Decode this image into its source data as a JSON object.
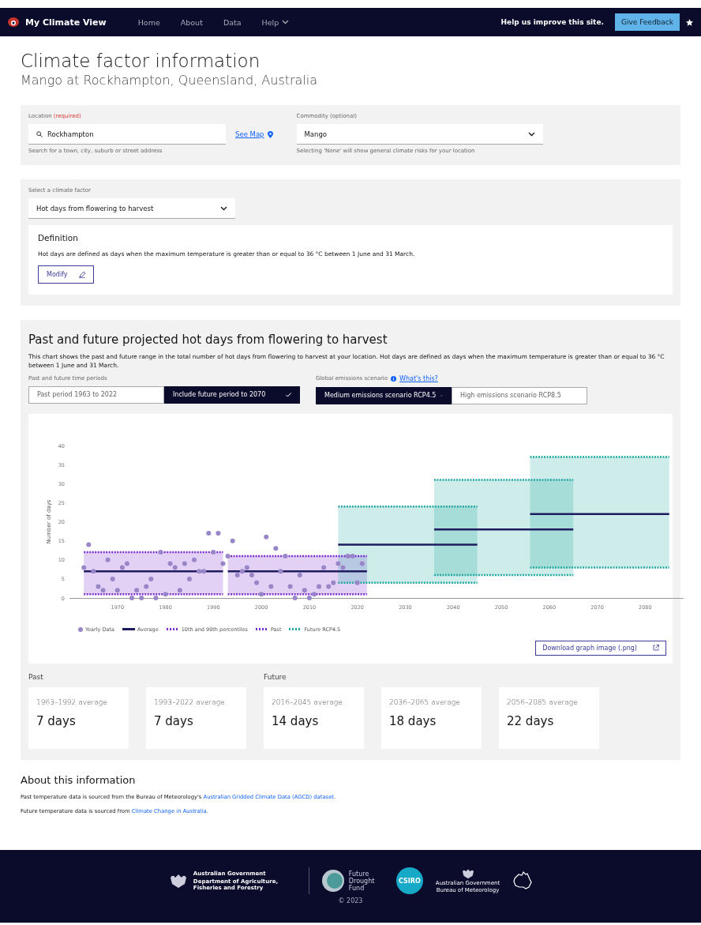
{
  "nav": {
    "brand": "My Climate View",
    "links": [
      {
        "label": "Home",
        "kind": "link"
      },
      {
        "label": "About",
        "kind": "link"
      },
      {
        "label": "Data",
        "kind": "link"
      },
      {
        "label": "Help",
        "kind": "dropdown"
      }
    ],
    "prompt": "Help us improve this site.",
    "feedback_button": "Give Feedback"
  },
  "page": {
    "title": "Climate factor information",
    "subtitle": "Mango at Rockhampton, Queensland, Australia"
  },
  "search_panel": {
    "location": {
      "label": "Location",
      "required_tag": "(required)",
      "value": "Rockhampton",
      "help": "Search for a town, city, suburb or street address",
      "map_link": "See Map"
    },
    "commodity": {
      "label": "Commodity (optional)",
      "value": "Mango",
      "help": "Selecting 'None' will show general climate risks for your location"
    }
  },
  "factor_panel": {
    "label": "Select a climate factor",
    "value": "Hot days from flowering to harvest",
    "definition": {
      "title": "Definition",
      "text": "Hot days are defined as days when the maximum temperature is greater than or equal to 36 °C between 1 June and 31 March.",
      "button": "Modify"
    }
  },
  "chart_section": {
    "title": "Past and future projected hot days from flowering to harvest",
    "description": "This chart shows the past and future range in the total number of hot days from flowering to harvest at your location. Hot days are defined as days when the maximum temperature is greater than or equal to 36 °C between 1 June and 31 March.",
    "period_toggle": {
      "label": "Past and future time periods",
      "options": [
        {
          "label": "Past period 1963 to 2022",
          "selected": false
        },
        {
          "label": "Include future period to 2070",
          "selected": true
        }
      ]
    },
    "scenario_toggle": {
      "label": "Global emissions scenario",
      "help_link": "What's this?",
      "options": [
        {
          "label": "Medium emissions scenario RCP4.5",
          "selected": true
        },
        {
          "label": "High emissions scenario RCP8.5",
          "selected": false
        }
      ]
    },
    "chart_data": {
      "type": "scatter",
      "ylabel": "Number of days",
      "ylim": [
        0,
        40
      ],
      "yticks": [
        0,
        5,
        10,
        15,
        20,
        25,
        30,
        35,
        40
      ],
      "xlim": [
        1960,
        2088
      ],
      "xticks": [
        1970,
        1980,
        1990,
        2000,
        2010,
        2020,
        2030,
        2040,
        2050,
        2060,
        2070,
        2080
      ],
      "series": [
        {
          "name": "Yearly Data",
          "type": "scatter",
          "color": "#9886c8",
          "x": [
            1963,
            1964,
            1965,
            1966,
            1967,
            1968,
            1969,
            1970,
            1971,
            1972,
            1973,
            1974,
            1975,
            1976,
            1977,
            1978,
            1979,
            1980,
            1981,
            1982,
            1983,
            1984,
            1985,
            1986,
            1987,
            1988,
            1989,
            1990,
            1991,
            1992,
            1993,
            1994,
            1995,
            1996,
            1997,
            1998,
            1999,
            2000,
            2001,
            2002,
            2003,
            2004,
            2005,
            2006,
            2007,
            2008,
            2009,
            2010,
            2011,
            2012,
            2013,
            2014,
            2015,
            2016,
            2017,
            2018,
            2019,
            2020,
            2021
          ],
          "values": [
            8,
            14,
            7,
            3,
            2,
            10,
            5,
            2,
            8,
            9,
            0,
            2,
            0,
            3,
            5,
            0,
            12,
            1,
            9,
            8,
            2,
            9,
            5,
            10,
            7,
            7,
            17,
            12,
            17,
            9,
            11,
            15,
            6,
            7,
            8,
            6,
            4,
            1,
            16,
            3,
            13,
            7,
            11,
            3,
            0,
            6,
            2,
            0,
            1,
            3,
            8,
            3,
            4,
            9,
            8,
            11,
            11,
            4,
            9
          ]
        },
        {
          "name": "Average",
          "type": "line",
          "line_style": "solid",
          "color": "#1e1b5e",
          "x": [
            1963,
            1992,
            null,
            1993,
            2022,
            null,
            2016,
            2045,
            null,
            2036,
            2065,
            null,
            2056,
            2085
          ],
          "values": [
            7,
            7,
            null,
            7,
            7,
            null,
            14,
            14,
            null,
            18,
            18,
            null,
            22,
            22
          ]
        },
        {
          "name": "Past",
          "type": "line",
          "line_style": "dotted",
          "color": "#7b2fd0",
          "x": [
            1963,
            1992,
            null,
            1993,
            2022
          ],
          "values": [
            12,
            12,
            null,
            11,
            11
          ]
        },
        {
          "type": "line",
          "line_style": "dotted",
          "color": "#7b2fd0",
          "x": [
            1963,
            1992,
            null,
            1993,
            2022
          ],
          "values": [
            1,
            1,
            null,
            1,
            1
          ]
        },
        {
          "name": "Future RCP4.5",
          "type": "line",
          "line_style": "dotted",
          "color": "#22a8a0",
          "x": [
            2016,
            2045
          ],
          "values": [
            24,
            24
          ]
        },
        {
          "type": "line",
          "line_style": "dotted",
          "color": "#22a8a0",
          "x": [
            2016,
            2045
          ],
          "values": [
            4,
            4
          ]
        },
        {
          "type": "line",
          "line_style": "dotted",
          "color": "#22a8a0",
          "x": [
            2036,
            2065
          ],
          "values": [
            31,
            31
          ]
        },
        {
          "type": "line",
          "line_style": "dotted",
          "color": "#22a8a0",
          "x": [
            2036,
            2065
          ],
          "values": [
            6,
            6
          ]
        },
        {
          "type": "line",
          "line_style": "dotted",
          "color": "#22a8a0",
          "x": [
            2056,
            2085
          ],
          "values": [
            37,
            37
          ]
        },
        {
          "type": "line",
          "line_style": "dotted",
          "color": "#22a8a0",
          "x": [
            2056,
            2085
          ],
          "values": [
            8,
            8
          ]
        }
      ]
    },
    "legend": [
      {
        "label": "10th and 90th percentiles",
        "kind": "dotted",
        "color": "#7b2fd0"
      }
    ],
    "download_button": "Download graph image (.png)",
    "stat_groups": [
      {
        "title": "Past",
        "cards": [
          {
            "period": "1963–1992 average",
            "value": "7 days"
          },
          {
            "period": "1993–2022 average",
            "value": "7 days"
          }
        ]
      },
      {
        "title": "Future",
        "cards": [
          {
            "period": "2016–2045 average",
            "value": "14 days"
          },
          {
            "period": "2036–2065 average",
            "value": "18 days"
          },
          {
            "period": "2056–2085 average",
            "value": "22 days"
          }
        ]
      }
    ]
  },
  "about": {
    "title": "About this information",
    "lines": [
      {
        "before": "Past temperature data is sourced from the Bureau of Meteorology's ",
        "link": "Australian Gridded Climate Data (AGCD) dataset",
        "after": "."
      },
      {
        "before": "Future temperature data is sourced from ",
        "link": "Climate Change in Australia",
        "after": "."
      }
    ]
  },
  "footer": {
    "agriculture": {
      "government": "Australian Government",
      "department": "Department of Agriculture, Fisheries and Forestry"
    },
    "fund": "Future Drought Fund",
    "csiro": "CSIRO",
    "bureau": {
      "government": "Australian Government",
      "agency": "Bureau of Meteorology"
    },
    "copyright": "© 2023"
  }
}
